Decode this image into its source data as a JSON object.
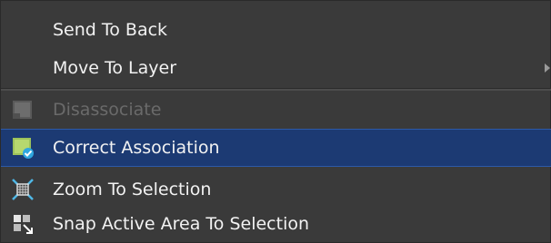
{
  "context_menu": {
    "items": [
      {
        "label": "Send To Back",
        "state": "normal",
        "icon": ""
      },
      {
        "label": "Move To Layer",
        "state": "normal",
        "icon": "submenu-arrow-icon",
        "has_submenu": true
      },
      {
        "label": "Disassociate",
        "state": "disabled",
        "icon": "disassociate-icon"
      },
      {
        "label": "Correct Association",
        "state": "selected",
        "icon": "correct-association-icon"
      },
      {
        "label": "Zoom To Selection",
        "state": "normal",
        "icon": "zoom-to-selection-icon"
      },
      {
        "label": "Snap Active Area To Selection",
        "state": "normal",
        "icon": "snap-active-area-icon"
      }
    ]
  },
  "colors": {
    "menu_background": "#3a3a3a",
    "selected_background": "#1c3a73",
    "selected_border": "#2d5aa8",
    "text_normal": "#f2f2f2",
    "text_disabled": "#6a6a6a"
  }
}
